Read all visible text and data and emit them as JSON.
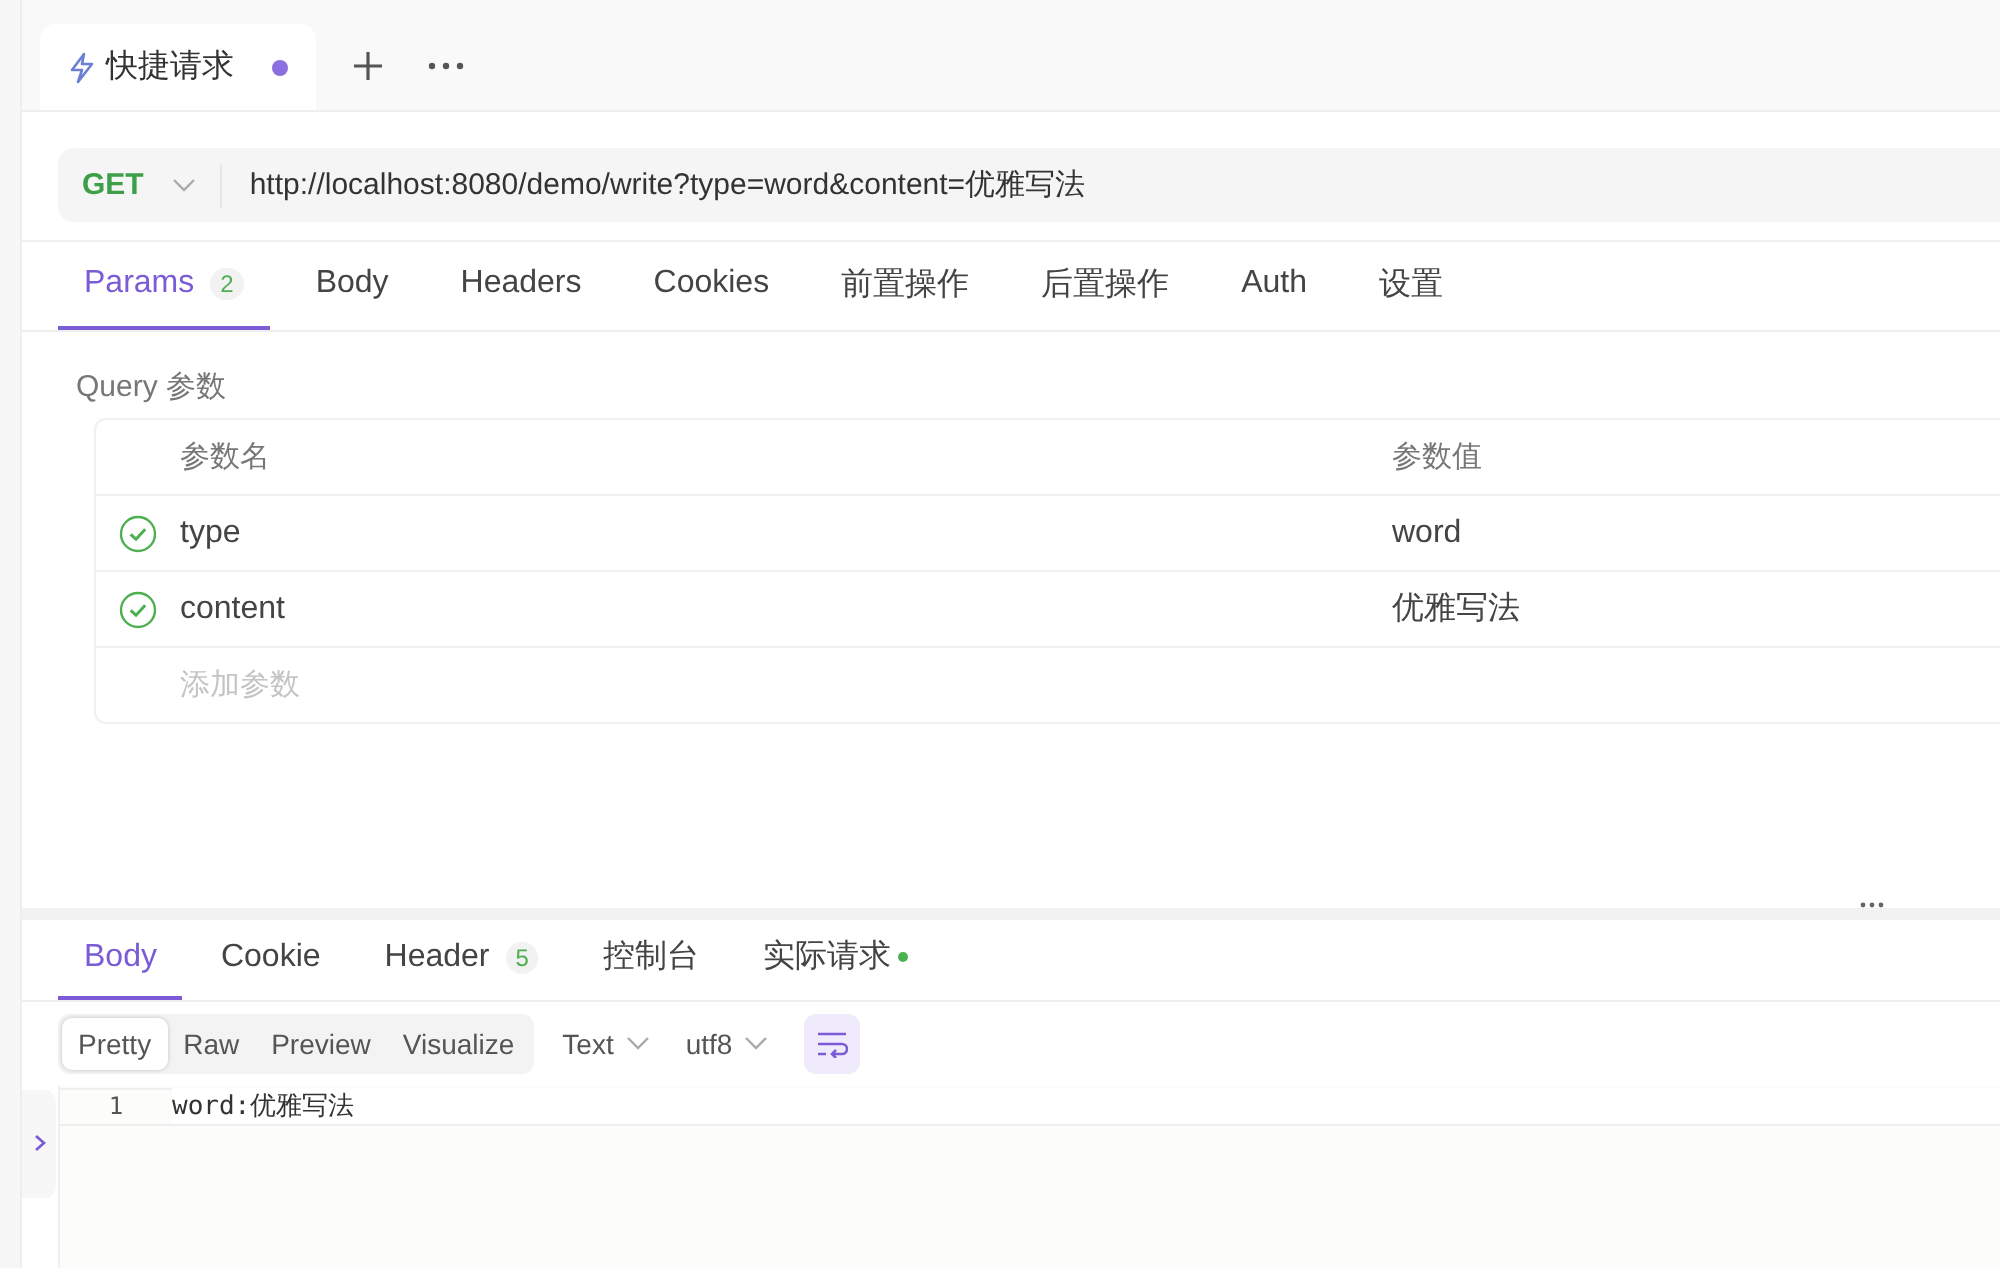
{
  "request_tabs": [
    {
      "title": "快捷请求",
      "selected": true,
      "unsaved": true
    }
  ],
  "request": {
    "method": "GET",
    "url": "http://localhost:8080/demo/write?type=word&content=优雅写法"
  },
  "request_sections": [
    {
      "label": "Params",
      "badge": "2",
      "selected": true
    },
    {
      "label": "Body",
      "selected": false
    },
    {
      "label": "Headers",
      "selected": false
    },
    {
      "label": "Cookies",
      "selected": false
    },
    {
      "label": "前置操作",
      "selected": false
    },
    {
      "label": "后置操作",
      "selected": false
    },
    {
      "label": "Auth",
      "selected": false
    },
    {
      "label": "设置",
      "selected": false
    }
  ],
  "query": {
    "title": "Query 参数",
    "columns": [
      "参数名",
      "参数值"
    ],
    "rows": [
      {
        "name": "type",
        "value": "word",
        "enabled": true
      },
      {
        "name": "content",
        "value": "优雅写法",
        "enabled": true
      }
    ],
    "add_placeholder": "添加参数"
  },
  "response_sections": [
    {
      "label": "Body",
      "selected": true
    },
    {
      "label": "Cookie",
      "selected": false
    },
    {
      "label": "Header",
      "badge": "5",
      "selected": false
    },
    {
      "label": "控制台",
      "selected": false
    },
    {
      "label": "实际请求",
      "dot": true,
      "selected": false
    }
  ],
  "view_modes": [
    {
      "label": "Pretty",
      "selected": true
    },
    {
      "label": "Raw",
      "selected": false
    },
    {
      "label": "Preview",
      "selected": false
    },
    {
      "label": "Visualize",
      "selected": false
    }
  ],
  "format": "Text",
  "encoding": "utf8",
  "wrap_on": true,
  "code_lines": [
    {
      "number": "1",
      "text": "word:优雅写法"
    }
  ]
}
